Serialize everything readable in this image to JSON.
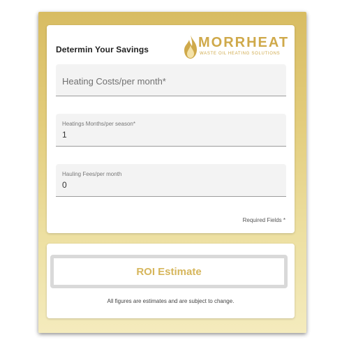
{
  "card": {
    "title": "Determin Your Savings",
    "logo": {
      "icon": "flame-icon",
      "name": "MORRHEAT",
      "tagline": "WASTE OIL HEATING SOLUTIONS"
    },
    "fields": [
      {
        "placeholder": "Heating Costs/per month*",
        "value": ""
      },
      {
        "label": "Heatings Months/per season*",
        "value": "1"
      },
      {
        "label": "Hauling Fees/per month",
        "value": "0"
      }
    ],
    "required_note": "Required Fields *"
  },
  "footer": {
    "button_label": "ROI Estimate",
    "disclaimer": "All figures are estimates and are subject to change."
  },
  "colors": {
    "gold": "#cfa94a",
    "button_text": "#d6b65c",
    "frame_top": "#d8bc62",
    "frame_bottom": "#f4ebbd"
  }
}
